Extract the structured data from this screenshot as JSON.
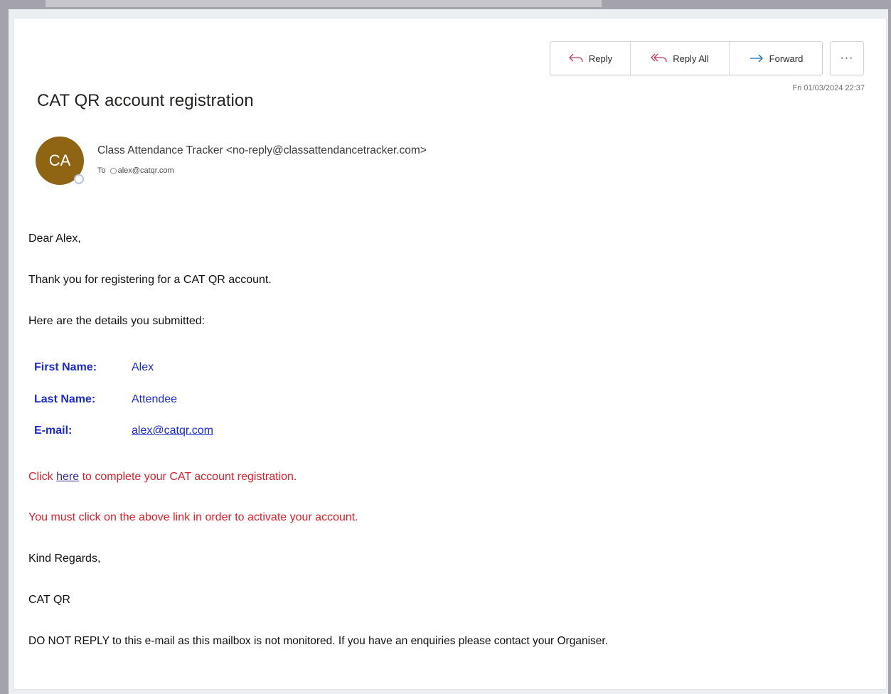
{
  "actions": {
    "reply_label": "Reply",
    "reply_all_label": "Reply All",
    "forward_label": "Forward",
    "more_label": "···"
  },
  "email": {
    "date": "Fri 01/03/2024 22:37",
    "subject": "CAT QR account registration",
    "avatar_initials": "CA",
    "sender": "Class Attendance Tracker <no-reply@classattendancetracker.com>",
    "to_label": "To",
    "to_address": "alex@catqr.com"
  },
  "body": {
    "greeting": "Dear Alex,",
    "thanks": "Thank you for registering for a CAT QR account.",
    "intro": "Here are the details you submitted:",
    "details": {
      "first_name_label": "First Name:",
      "first_name_value": "Alex",
      "last_name_label": "Last Name:",
      "last_name_value": "Attendee",
      "email_label": "E-mail:",
      "email_value": "alex@catqr.com"
    },
    "click_prefix": "Click ",
    "click_link": "here",
    "click_suffix": " to complete your CAT account registration.",
    "must_click": "You must click on the above link in order to activate your account.",
    "regards": "Kind Regards,",
    "signature": "CAT QR",
    "footer": "DO NOT REPLY to this e-mail as this mailbox is not monitored. If you have an enquiries please contact your Organiser."
  },
  "colors": {
    "avatar": "#8f6513",
    "detail_blue": "#1b2ad3",
    "warning_red": "#e1202b",
    "forward_arrow": "#0f6cbd"
  }
}
